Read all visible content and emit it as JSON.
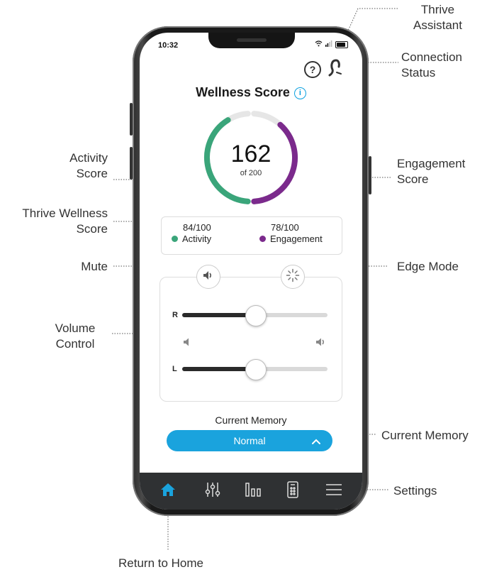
{
  "statusbar": {
    "time": "10:32"
  },
  "header": {
    "title": "Wellness Score",
    "help_symbol": "?"
  },
  "wellness": {
    "score": "162",
    "score_of": "of 200",
    "activity_value": "84/100",
    "activity_label": "Activity",
    "engagement_value": "78/100",
    "engagement_label": "Engagement",
    "activity_fraction": 0.84,
    "engagement_fraction": 0.78
  },
  "volume": {
    "right_label": "R",
    "left_label": "L",
    "right_level": 0.5,
    "left_level": 0.5
  },
  "memory": {
    "label": "Current Memory",
    "value": "Normal"
  },
  "tabs": [
    "home-icon",
    "equalizer-icon",
    "bar-chart-icon",
    "remote-icon",
    "menu-icon"
  ],
  "callouts": {
    "thrive_assistant": "Thrive\nAssistant",
    "connection_status": "Connection\nStatus",
    "activity_score": "Activity\nScore",
    "engagement_score": "Engagement\nScore",
    "thrive_wellness_score": "Thrive Wellness\nScore",
    "mute": "Mute",
    "edge_mode": "Edge Mode",
    "volume_control": "Volume\nControl",
    "current_memory": "Current Memory",
    "settings": "Settings",
    "return_to_home": "Return to Home"
  },
  "colors": {
    "activity": "#3aa57a",
    "engagement": "#7b2a8c",
    "accent": "#1aa3dd",
    "track": "#e6e6e6"
  }
}
